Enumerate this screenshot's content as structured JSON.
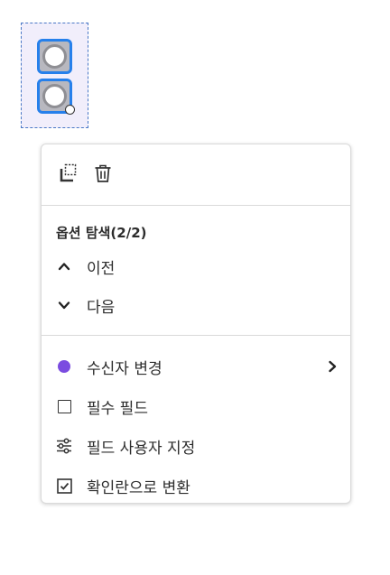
{
  "menu": {
    "toolbar": {
      "duplicate_icon": "duplicate-icon",
      "delete_icon": "trash-icon"
    },
    "navigation": {
      "title": "옵션 탐색(2/2)",
      "prev_label": "이전",
      "next_label": "다음"
    },
    "items": {
      "change_recipient": "수신자 변경",
      "required_field": "필수 필드",
      "customize_field": "필드 사용자 지정",
      "convert_checkbox": "확인란으로 변환"
    }
  },
  "colors": {
    "recipient": "#7b4ce0",
    "selection_border": "#2680eb",
    "selection_bg": "#f1eefb"
  }
}
